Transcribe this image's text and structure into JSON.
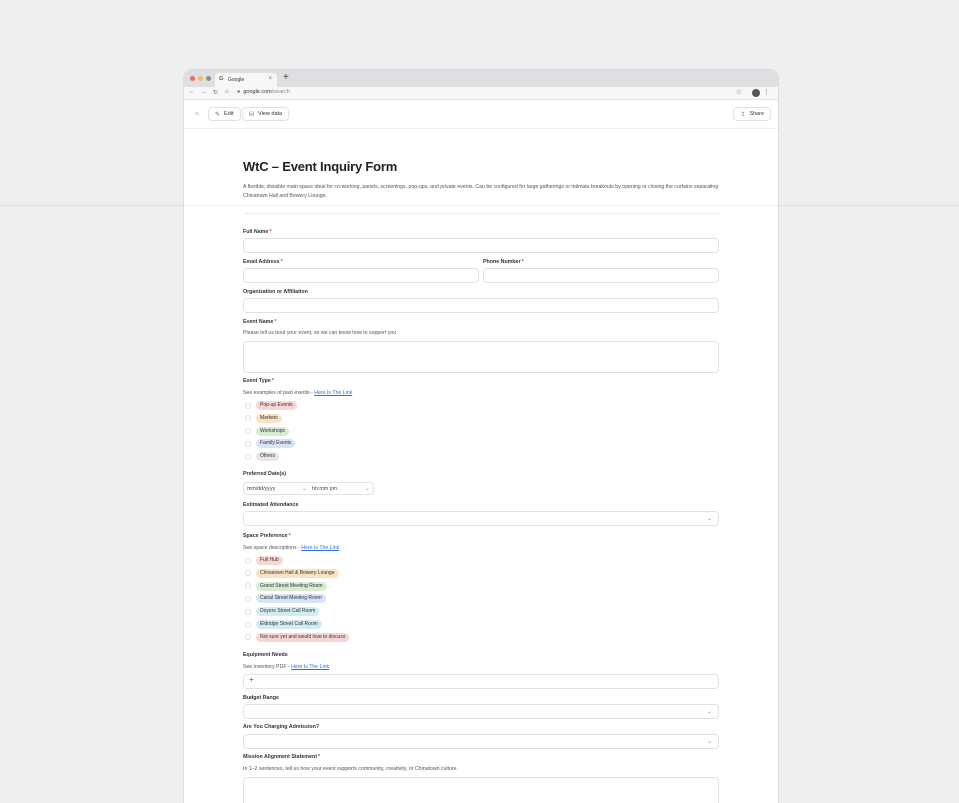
{
  "browser": {
    "tab_icon": "G",
    "tab_title": "Google",
    "tab_close": "×",
    "new_tab": "+",
    "url_host": "google.com",
    "url_path": "/search",
    "back": "←",
    "forward": "→",
    "reload": "↻",
    "home": "⌂",
    "lock": "🔒",
    "bookmark": "☆",
    "menu": "⋮",
    "dots": [
      "#ec6a5e",
      "#f4bf4f",
      "#8e8e8e"
    ]
  },
  "toolbar": {
    "home_icon": "⌂",
    "edit_icon": "✎",
    "edit_label": "Edit",
    "data_icon": "⛁",
    "view_data_label": "View data",
    "share_icon": "⇪",
    "share_label": "Share"
  },
  "form": {
    "title": "WtC – Event Inquiry Form",
    "description": "A flexible, divisible main space ideal for co-working, panels, screenings, pop-ups, and private events. Can be configured for large gatherings or intimate breakouts by opening or closing the curtains separating Chinatown Hall and Bowery Lounge.",
    "required_mark": "*",
    "full_name_label": "Full Name",
    "email_label": "Email Address",
    "phone_label": "Phone Number",
    "org_label": "Organization or Affiliation",
    "event_name_label": "Event Name",
    "event_name_help": "Please tell us bout your event, so we can know how to support you",
    "event_type_label": "Event Type",
    "event_type_help": "See examples of past events - ",
    "event_type_link": "Here Is The Link",
    "event_types": [
      {
        "label": "Pop-up Events",
        "color": "#f8d7d3"
      },
      {
        "label": "Markets",
        "color": "#fbe2c4"
      },
      {
        "label": "Workshops",
        "color": "#d7ecd2"
      },
      {
        "label": "Family Events",
        "color": "#d6e4f6"
      },
      {
        "label": "Others",
        "color": "#e6e6e6"
      }
    ],
    "dates_label": "Preferred Date(s)",
    "date_placeholder": "mm/dd/yyyy",
    "time_placeholder": "hh:mm pm",
    "chevron": "⌄",
    "attendance_label": "Estimated Attendance",
    "space_label": "Space Preference",
    "space_help": "See space descriptions - ",
    "space_link": "Here Is The Link",
    "spaces": [
      {
        "label": "Full Hub",
        "color": "#f8d7d3"
      },
      {
        "label": "Chinatown Hall & Bowery Lounge",
        "color": "#fbe2c4"
      },
      {
        "label": "Grand Street Meeting Room",
        "color": "#d7ecd2"
      },
      {
        "label": "Canal Street Meeting Room",
        "color": "#d6e4f6"
      },
      {
        "label": "Doyers Street Call Room",
        "color": "#d3ecf3"
      },
      {
        "label": "Eldridge Street Call Room",
        "color": "#d3ecf3"
      },
      {
        "label": "Not sure yet and would love to discuss",
        "color": "#f8d7d3"
      }
    ],
    "equipment_label": "Equipment Needs",
    "equipment_help": "See inventory PDF - ",
    "equipment_link": "Here Is The Link",
    "add_icon": "+",
    "budget_label": "Budget Range",
    "admission_label": "Are You Charging Admission?",
    "mission_label": "Mission Alignment Statement",
    "mission_help": "In 1–2 sentences, tell us how your event supports community, creativity, or Chinatown culture."
  }
}
